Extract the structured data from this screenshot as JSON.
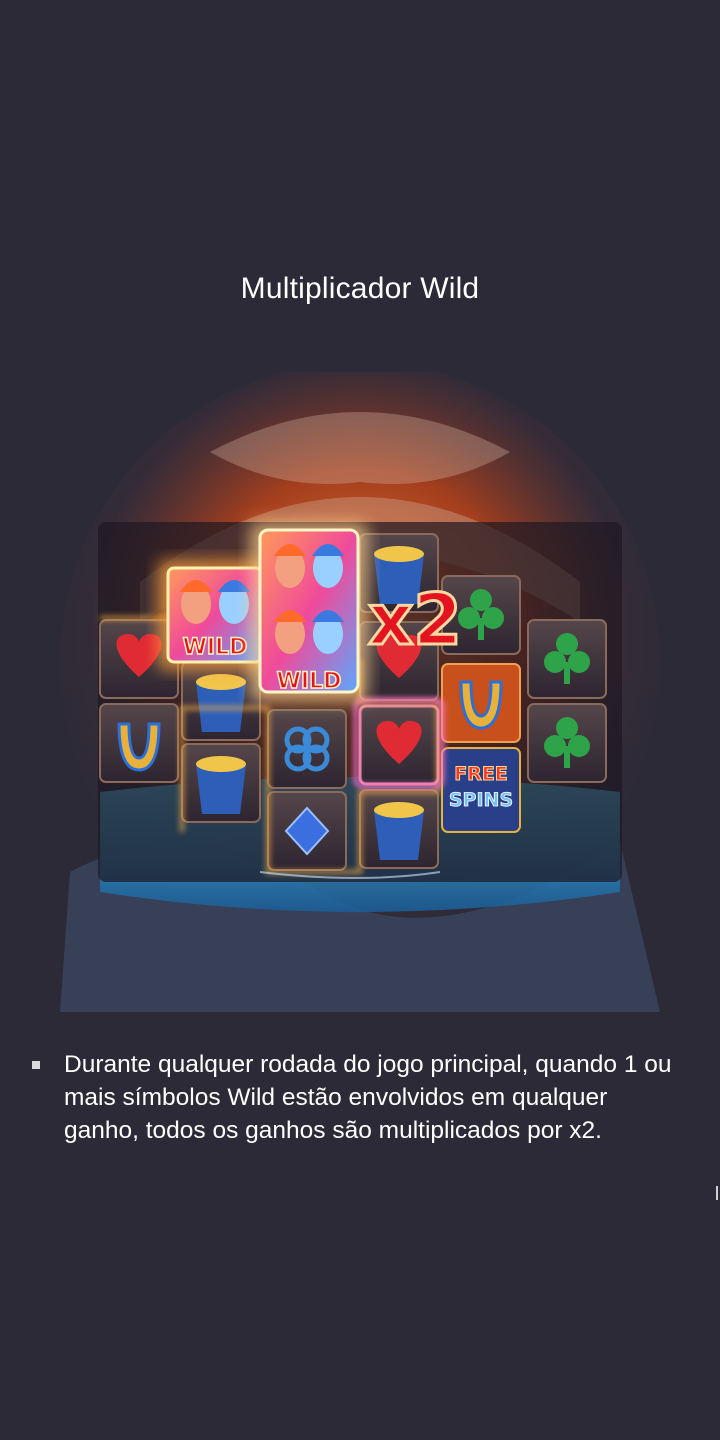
{
  "page": {
    "title": "Multiplicador Wild"
  },
  "illustration": {
    "wild_label": "WILD",
    "multiplier_label": "x2",
    "free_spins_line1": "FREE",
    "free_spins_line2": "SPINS",
    "icons": [
      "wild-goddess-icon",
      "heart-icon",
      "club-icon",
      "horseshoe-icon",
      "treasure-bucket-icon",
      "diamond-icon",
      "clover-icon",
      "free-spins-icon"
    ]
  },
  "rules": [
    {
      "text": "Durante qualquer rodada do jogo principal, quando 1 ou mais símbolos Wild estão envolvidos em qualquer ganho, todos os ganhos são multiplicados por x2."
    }
  ],
  "colors": {
    "background": "#2b2a36",
    "glow_orange": "#ffb347",
    "glow_pink": "#ff4fd8",
    "multiplier_red": "#e3141f",
    "water_blue": "#2fa3d8"
  }
}
